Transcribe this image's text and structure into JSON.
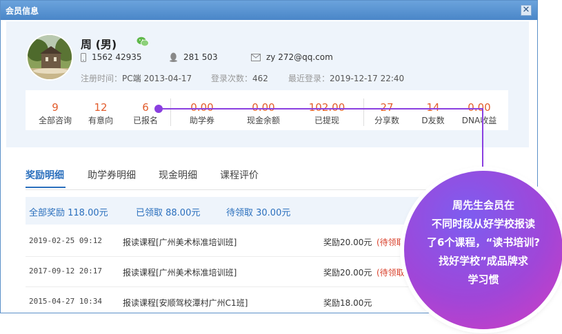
{
  "window": {
    "title": "会员信息",
    "close_glyph": "✕"
  },
  "profile": {
    "name": "周 (男)",
    "phone": "1562 42935",
    "qq": "281 503",
    "email": "zy 272@qq.com",
    "register_label": "注册时间：",
    "register_value": "PC端 2013-04-17",
    "login_count_label": "登录次数：",
    "login_count_value": "462",
    "last_login_label": "最近登录：",
    "last_login_value": "2019-12-17 22:40"
  },
  "stats": [
    {
      "value": "9",
      "label": "全部咨询"
    },
    {
      "value": "12",
      "label": "有意向"
    },
    {
      "value": "6",
      "label": "已报名"
    },
    {
      "value": "0.00",
      "label": "助学券"
    },
    {
      "value": "0.00",
      "label": "现金余额"
    },
    {
      "value": "102.00",
      "label": "已提现"
    },
    {
      "value": "27",
      "label": "分享数"
    },
    {
      "value": "14",
      "label": "D友数"
    },
    {
      "value": "0.00",
      "label": "DNA收益"
    }
  ],
  "tabs": [
    "奖励明细",
    "助学券明细",
    "现金明细",
    "课程评价"
  ],
  "summary": {
    "total": "全部奖励 118.00元",
    "received": "已领取 88.00元",
    "pending": "待领取 30.00元"
  },
  "rows": [
    {
      "date": "2019-02-25 09:12",
      "desc": "报读课程[广州美术标准培训班]",
      "amount": "奖励20.00元",
      "status": "(待领取"
    },
    {
      "date": "2017-09-12 20:17",
      "desc": "报读课程[广州美术标准培训班]",
      "amount": "奖励20.00元",
      "status": "(待领取"
    },
    {
      "date": "2015-04-27 10:34",
      "desc": "报读课程[安顺驾校潭村广州C1班]",
      "amount": "奖励18.00元",
      "status": ""
    }
  ],
  "callout": {
    "lines": [
      "周先生会员在",
      "不同时段从好学校报读",
      "了6个课程，“读书培训?",
      "找好学校”成品牌求",
      "学习惯"
    ]
  },
  "colors": {
    "accent": "#2a6fbd",
    "value_orange": "#e25c2c",
    "callout_purple": "#8a3fe0"
  }
}
